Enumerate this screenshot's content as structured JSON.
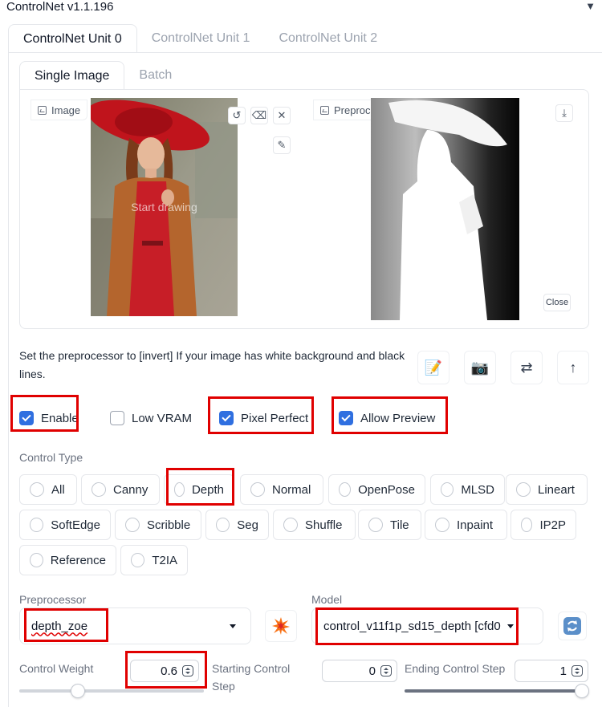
{
  "app": {
    "title": "ControlNet v1.1.196"
  },
  "unit_tabs": [
    "ControlNet Unit 0",
    "ControlNet Unit 1",
    "ControlNet Unit 2"
  ],
  "image_tabs": [
    "Single Image",
    "Batch"
  ],
  "image_area": {
    "image_label": "Image",
    "canvas_overlay": "Start drawing",
    "preview_label": "Preprocessor Preview",
    "close_label": "Close",
    "tools": [
      "undo-icon",
      "eraser-icon",
      "close-icon",
      "brush-icon"
    ],
    "preview_tools": [
      "download-icon"
    ]
  },
  "hint_text": "Set the preprocessor to [invert] If your image has white background and black lines.",
  "action_buttons": [
    "edit-note-icon",
    "camera-icon",
    "swap-icon",
    "upload-arrow-icon"
  ],
  "checkboxes": [
    {
      "label": "Enable",
      "checked": true
    },
    {
      "label": "Low VRAM",
      "checked": false
    },
    {
      "label": "Pixel Perfect",
      "checked": true
    },
    {
      "label": "Allow Preview",
      "checked": true
    }
  ],
  "control_type": {
    "label": "Control Type",
    "options": [
      "All",
      "Canny",
      "Depth",
      "Normal",
      "OpenPose",
      "MLSD",
      "Lineart",
      "SoftEdge",
      "Scribble",
      "Seg",
      "Shuffle",
      "Tile",
      "Inpaint",
      "IP2P",
      "Reference",
      "T2IA"
    ],
    "selected": "Depth"
  },
  "preprocessor": {
    "label": "Preprocessor",
    "value": "depth_zoe",
    "run_icon": "explosion-icon"
  },
  "model": {
    "label": "Model",
    "value": "control_v11f1p_sd15_depth [cfd0",
    "refresh_icon": "refresh-icon"
  },
  "control_weight": {
    "label": "Control Weight",
    "value": "0.6"
  },
  "starting_step": {
    "label": "Starting Control Step",
    "value": "0"
  },
  "ending_step": {
    "label": "Ending Control Step",
    "value": "1"
  },
  "colors": {
    "accent": "#2f6fe0",
    "highlight": "#e00000"
  }
}
